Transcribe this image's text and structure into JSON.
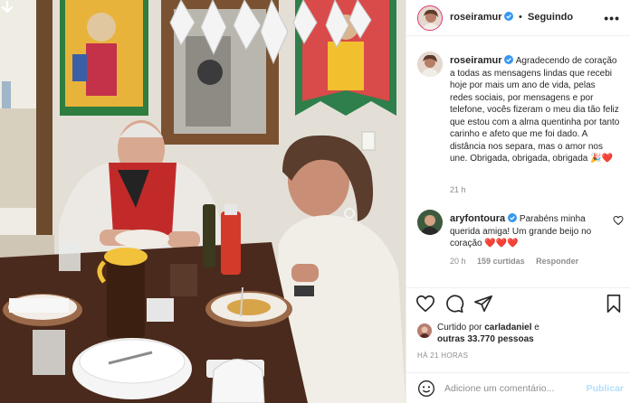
{
  "post": {
    "author": "roseiramur",
    "follow_separator": "•",
    "follow_label": "Seguindo",
    "more_label": "•••"
  },
  "caption": {
    "username": "roseiramur",
    "text": "Agradecendo de coração a todas as mensagens lindas que recebi hoje por mais um ano de vida, pelas redes sociais, por mensagens e por telefone, vocês fizeram o meu dia tão feliz que estou com a alma quentinha por tanto carinho e afeto que me foi dado. A distância nos separa, mas o amor nos une. Obrigada, obrigada, obrigada 🎉❤️",
    "time": "21 h"
  },
  "comment": {
    "username": "aryfontoura",
    "text": "Parabéns minha querida amiga! Um grande beijo no coração ❤️❤️❤️",
    "time": "20 h",
    "likes": "159 curtidas",
    "reply_label": "Responder"
  },
  "likes": {
    "prefix": "Curtido por",
    "user": "carladaniel",
    "connector": "e",
    "others": "outras 33.770 pessoas"
  },
  "post_time": "HÁ 21 HORAS",
  "add_comment": {
    "placeholder": "Adicione um comentário...",
    "publish_label": "Publicar"
  },
  "colors": {
    "verified": "#3897f0",
    "heart": "#ed4956",
    "publish_disabled": "#b2dffc",
    "story_ring": "#e1306c"
  },
  "icons": [
    "back-arrow-icon",
    "verified-icon",
    "heart-icon",
    "comment-icon",
    "share-icon",
    "bookmark-icon",
    "emoji-icon"
  ]
}
